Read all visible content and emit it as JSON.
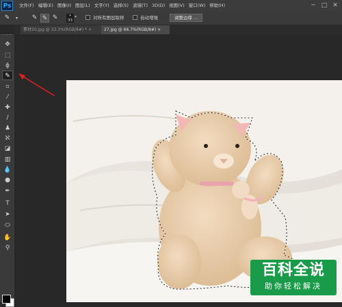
{
  "app": {
    "logo": "Ps"
  },
  "menubar": {
    "items": [
      "文件(F)",
      "编辑(E)",
      "图像(I)",
      "图层(L)",
      "文字(Y)",
      "选择(S)",
      "滤镜(T)",
      "3D(D)",
      "视图(V)",
      "窗口(W)",
      "帮助(H)"
    ]
  },
  "window_controls": {
    "minimize": "─",
    "maximize": "□",
    "close": "✕"
  },
  "options_bar": {
    "brush_size": "33",
    "sample_all_layers_label": "对所有图层取样",
    "auto_enhance_label": "自动增强",
    "refine_edge_label": "调整边缘 ..."
  },
  "tabs": [
    {
      "label": "素材20.jpg @ 33.3%(RGB/8#) *",
      "close": "×",
      "active": false
    },
    {
      "label": "27.jpg @ 66.7%(RGB/8#)",
      "close": "×",
      "active": true
    }
  ],
  "tools": [
    {
      "name": "move-tool",
      "icon": "move-icon",
      "glyph": "✥"
    },
    {
      "name": "marquee-tool",
      "icon": "marquee-icon",
      "glyph": "⬚"
    },
    {
      "name": "lasso-tool",
      "icon": "lasso-icon",
      "glyph": "ϕ"
    },
    {
      "name": "quick-selection-tool",
      "icon": "quick-selection-icon",
      "glyph": "✎",
      "active": true
    },
    {
      "name": "crop-tool",
      "icon": "crop-icon",
      "glyph": "⌗"
    },
    {
      "name": "eyedropper-tool",
      "icon": "eyedropper-icon",
      "glyph": "⁄"
    },
    {
      "name": "healing-brush-tool",
      "icon": "healing-icon",
      "glyph": "✚"
    },
    {
      "name": "brush-tool",
      "icon": "brush-icon",
      "glyph": "∕"
    },
    {
      "name": "clone-stamp-tool",
      "icon": "stamp-icon",
      "glyph": "♟"
    },
    {
      "name": "history-brush-tool",
      "icon": "history-brush-icon",
      "glyph": "ℵ"
    },
    {
      "name": "eraser-tool",
      "icon": "eraser-icon",
      "glyph": "◪"
    },
    {
      "name": "gradient-tool",
      "icon": "gradient-icon",
      "glyph": "▥"
    },
    {
      "name": "blur-tool",
      "icon": "blur-icon",
      "glyph": "💧"
    },
    {
      "name": "dodge-tool",
      "icon": "dodge-icon",
      "glyph": "●"
    },
    {
      "name": "pen-tool",
      "icon": "pen-icon",
      "glyph": "✒"
    },
    {
      "name": "type-tool",
      "icon": "type-icon",
      "glyph": "T"
    },
    {
      "name": "path-selection-tool",
      "icon": "path-selection-icon",
      "glyph": "➤"
    },
    {
      "name": "shape-tool",
      "icon": "shape-icon",
      "glyph": "⬭"
    },
    {
      "name": "hand-tool",
      "icon": "hand-icon",
      "glyph": "✋"
    },
    {
      "name": "zoom-tool",
      "icon": "zoom-icon",
      "glyph": "⚲"
    }
  ],
  "colors": {
    "foreground": "#000000",
    "background": "#ffffff",
    "accent": "#31a8ff",
    "arrow": "#e02020",
    "watermark_bg": "#1a9b4a"
  },
  "watermark": {
    "title": "百科全说",
    "subtitle": "助你轻松解决"
  }
}
